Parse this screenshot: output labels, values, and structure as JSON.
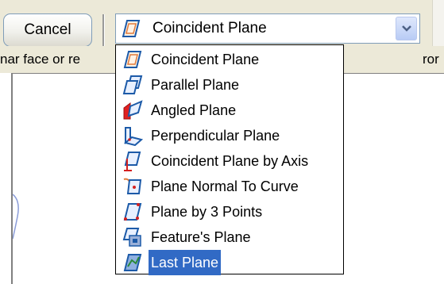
{
  "toolbar": {
    "cancel_label": "Cancel"
  },
  "combo": {
    "selected_value": "Coincident Plane",
    "selected_icon": "coincident-plane-icon"
  },
  "prompt": {
    "left_fragment": "nar face or re",
    "right_fragment": "ror"
  },
  "dropdown": {
    "options": [
      {
        "label": "Coincident Plane",
        "icon": "coincident-plane-icon"
      },
      {
        "label": "Parallel Plane",
        "icon": "parallel-plane-icon"
      },
      {
        "label": "Angled Plane",
        "icon": "angled-plane-icon"
      },
      {
        "label": "Perpendicular Plane",
        "icon": "perpendicular-plane-icon"
      },
      {
        "label": "Coincident Plane by Axis",
        "icon": "coincident-plane-by-axis-icon"
      },
      {
        "label": "Plane Normal To Curve",
        "icon": "plane-normal-to-curve-icon"
      },
      {
        "label": "Plane by 3 Points",
        "icon": "plane-by-3-points-icon"
      },
      {
        "label": "Feature's Plane",
        "icon": "features-plane-icon"
      },
      {
        "label": "Last Plane",
        "icon": "last-plane-icon"
      }
    ],
    "highlighted": "Last Plane"
  },
  "colors": {
    "toolbar_bg": "#ece9d8",
    "highlight_bg": "#316ac5",
    "icon_blue": "#1c5aa8",
    "icon_red": "#d42020"
  }
}
